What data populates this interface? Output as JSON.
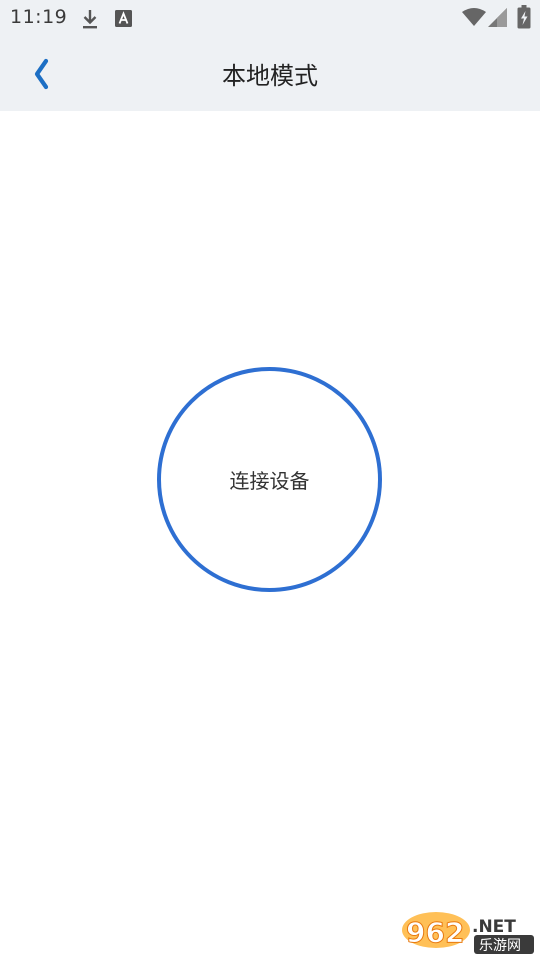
{
  "status_bar": {
    "time": "11:19",
    "icons": [
      "download-icon",
      "font-a-icon",
      "wifi-icon",
      "cell-signal-icon",
      "battery-charging-icon"
    ]
  },
  "app_bar": {
    "back_icon": "chevron-left-icon",
    "title": "本地模式",
    "accent_color": "#1d6fc4"
  },
  "main": {
    "connect_label": "连接设备",
    "ring_color": "#2e6fd2"
  },
  "watermark": {
    "brand": "962",
    "suffix": ".NET",
    "sub": "乐游网"
  }
}
